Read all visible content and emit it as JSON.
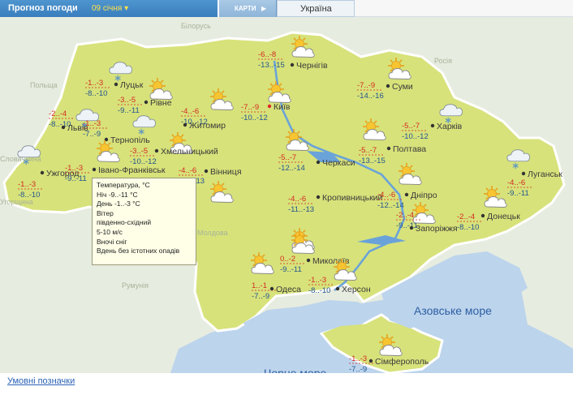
{
  "header": {
    "title": "Прогноз погоди",
    "date": "09 січня",
    "maps_tab": "КАРТИ",
    "region_tab": "Україна"
  },
  "colors": {
    "land": "#d7e27a",
    "sea": "#bcd4ec",
    "neighbor_land": "#e7ece0",
    "temp_night": "#d42a22",
    "temp_day": "#25558f"
  },
  "neighbors": [
    "Білорусь",
    "Польща",
    "Росія",
    "Словаччина",
    "Угорщина",
    "Румунія",
    "Молдова"
  ],
  "seas": [
    "Азовське море",
    "Чорне море"
  ],
  "cities": [
    {
      "name": "Чернігів",
      "night": "-6..-8",
      "day": "-13..-15",
      "icon": "partly-cloudy-icon"
    },
    {
      "name": "Луцьк",
      "night": "-1..-3",
      "day": "-8..-10",
      "icon": "snow-cloud-icon"
    },
    {
      "name": "Рівне",
      "night": "-3..-5",
      "day": "-9..-11",
      "icon": "partly-cloudy-icon"
    },
    {
      "name": "Суми",
      "night": "-7..-9",
      "day": "-14..-16",
      "icon": "partly-cloudy-icon"
    },
    {
      "name": "Київ",
      "night": "-7..-9",
      "day": "-10..-12",
      "icon": "partly-cloudy-icon"
    },
    {
      "name": "Житомир",
      "night": "-4..-6",
      "day": "-10..-12",
      "icon": "partly-cloudy-icon"
    },
    {
      "name": "Львів",
      "night": "-2..-4",
      "day": "-8..-10",
      "icon": "snow-cloud-icon"
    },
    {
      "name": "Тернопіль",
      "night": "-1..-3",
      "day": "-7..-9",
      "icon": "snow-cloud-icon"
    },
    {
      "name": "Харків",
      "night": "-5..-7",
      "day": "-10..-12",
      "icon": "snow-cloud-icon"
    },
    {
      "name": "Хмельницький",
      "night": "-3..-5",
      "day": "-10..-12",
      "icon": "partly-cloudy-icon"
    },
    {
      "name": "Полтава",
      "night": "-5..-7",
      "day": "-13..-15",
      "icon": "partly-cloudy-icon"
    },
    {
      "name": "Черкаси",
      "night": "-5..-7",
      "day": "-12..-14",
      "icon": "partly-cloudy-icon"
    },
    {
      "name": "Ужгород",
      "night": "-1..-3",
      "day": "-8..-10",
      "icon": "snow-cloud-icon"
    },
    {
      "name": "Івано-Франківськ",
      "night": "-1..-3",
      "day": "-9..-11",
      "icon": "partly-cloudy-icon"
    },
    {
      "name": "Вінниця",
      "night": "-4..-6",
      "day": "-11..-13",
      "icon": "partly-cloudy-icon"
    },
    {
      "name": "Луганськ",
      "night": "-4..-6",
      "day": "-9..-11",
      "icon": "snow-cloud-icon"
    },
    {
      "name": "Кропивницький",
      "night": "-4..-6",
      "day": "-11..-13",
      "icon": "partly-cloudy-icon"
    },
    {
      "name": "Дніпро",
      "night": "-4..-6",
      "day": "-12..-14",
      "icon": "partly-cloudy-icon"
    },
    {
      "name": "Донецьк",
      "night": "-2..-4",
      "day": "-8..-10",
      "icon": "partly-cloudy-icon"
    },
    {
      "name": "Запоріжжя",
      "night": "-2..-4",
      "day": "-9..-11",
      "icon": "partly-cloudy-icon"
    },
    {
      "name": "Миколаїв",
      "night": "0..-2",
      "day": "-9..-11",
      "icon": "partly-cloudy-icon"
    },
    {
      "name": "Одеса",
      "night": "1..-1",
      "day": "-7..-9",
      "icon": "partly-cloudy-icon"
    },
    {
      "name": "Херсон",
      "night": "-1..-3",
      "day": "-8..-10",
      "icon": "partly-cloudy-icon"
    },
    {
      "name": "Сімферополь",
      "night": "-1..-3",
      "day": "-7..-9",
      "icon": "partly-cloudy-icon"
    }
  ],
  "tooltip": {
    "line1": "Температура, °C",
    "line2": "Ніч -9..-11 °C",
    "line3": "День -1..-3 °C",
    "line4": "Вітер",
    "line5": "південно-східний",
    "line6": "5-10 м/с",
    "line7": "Вночі сніг",
    "line8": "Вдень без істотних опадів"
  },
  "footer": {
    "legend_link": "Умовні позначки"
  }
}
